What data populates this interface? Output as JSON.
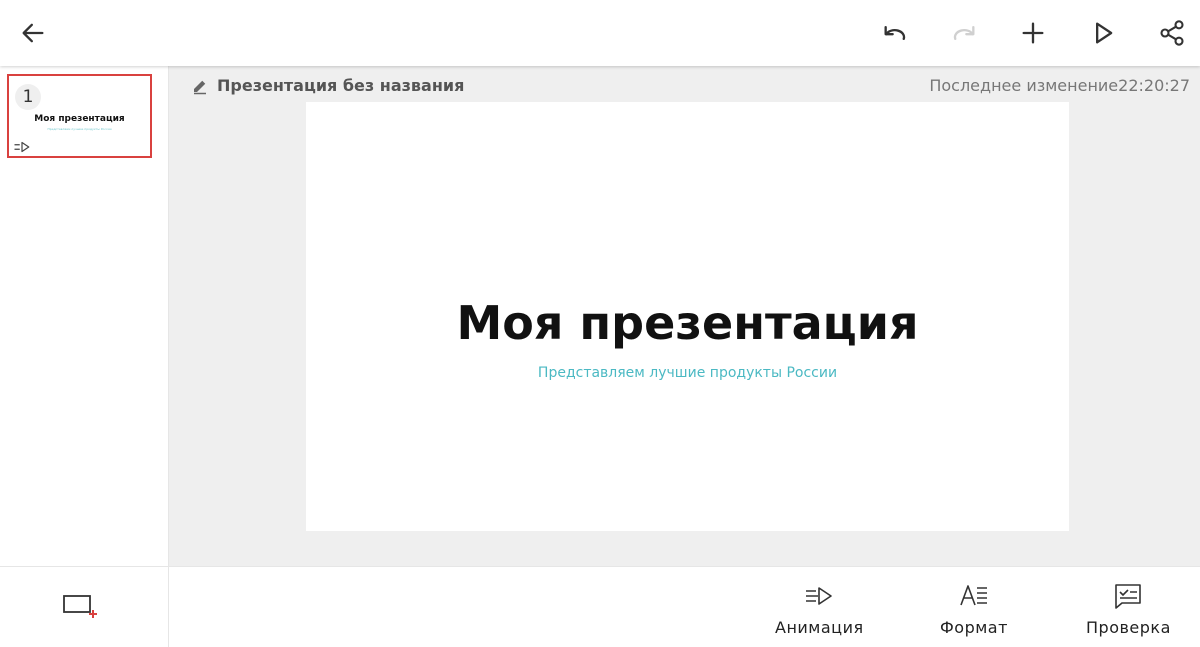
{
  "toolbar": {
    "back_icon": "arrow-left-icon",
    "undo_icon": "undo-icon",
    "redo_icon": "redo-icon",
    "add_icon": "plus-icon",
    "play_icon": "play-icon",
    "share_icon": "share-icon"
  },
  "document": {
    "title": "Презентация без названия",
    "last_modified_label": "Последнее изменение",
    "last_modified_time": "22:20:27"
  },
  "slides": [
    {
      "number": "1",
      "title": "Моя презентация",
      "subtitle": "Представляем лучшие продукты России"
    }
  ],
  "slide": {
    "title": "Моя презентация",
    "subtitle": "Представляем лучшие продукты России"
  },
  "bottom": {
    "animation_label": "Анимация",
    "format_label": "Формат",
    "review_label": "Проверка"
  },
  "colors": {
    "accent_red": "#d9413f",
    "subtitle_teal": "#4bb9c3"
  }
}
